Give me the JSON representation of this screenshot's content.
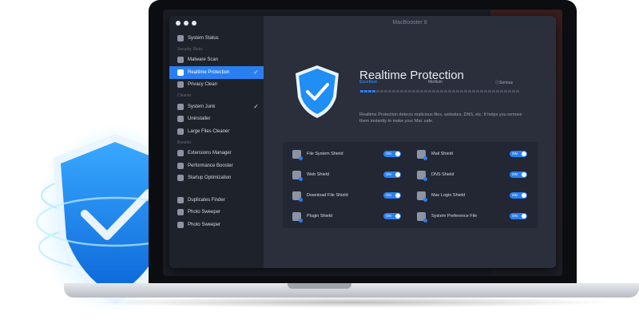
{
  "window": {
    "title": "MacBooster 8"
  },
  "sidebar": {
    "items": [
      {
        "type": "item",
        "label": "System Status",
        "icon": "gauge-icon"
      },
      {
        "type": "section",
        "label": "Security Risks"
      },
      {
        "type": "item",
        "label": "Malware Scan",
        "icon": "bug-icon"
      },
      {
        "type": "item",
        "label": "Realtime Protection",
        "icon": "shield-icon",
        "active": true,
        "checked": true
      },
      {
        "type": "item",
        "label": "Privacy Clean",
        "icon": "eye-icon"
      },
      {
        "type": "section",
        "label": "Cleaner"
      },
      {
        "type": "item",
        "label": "System Junk",
        "icon": "trash-icon",
        "checked": true
      },
      {
        "type": "item",
        "label": "Uninstaller",
        "icon": "box-icon"
      },
      {
        "type": "item",
        "label": "Large Files Cleaner",
        "icon": "file-icon"
      },
      {
        "type": "section",
        "label": "Booster"
      },
      {
        "type": "item",
        "label": "Extensions Manager",
        "icon": "puzzle-icon"
      },
      {
        "type": "item",
        "label": "Performance Booster",
        "icon": "rocket-icon"
      },
      {
        "type": "item",
        "label": "Startup Optimization",
        "icon": "power-icon"
      },
      {
        "type": "section",
        "label": ""
      },
      {
        "type": "item",
        "label": "Duplicates Finder",
        "icon": "copy-icon"
      },
      {
        "type": "item",
        "label": "Photo Sweeper",
        "icon": "photo-icon"
      },
      {
        "type": "item",
        "label": "Photo Sweeper",
        "icon": "photo-icon"
      }
    ]
  },
  "main": {
    "title": "Realtime Protection",
    "levels": [
      "Excellent",
      "Medium",
      "Serious"
    ],
    "level_value": 0.1,
    "description": "Realtime Protection detects malicious files, websites, DNS, etc. It helps you remove them instantly to make your Mac safe.",
    "shields": [
      {
        "label": "File System Shield",
        "state": "ON",
        "icon": "file-shield-icon"
      },
      {
        "label": "Mail Shield",
        "state": "ON",
        "icon": "mail-shield-icon"
      },
      {
        "label": "Web Shield",
        "state": "ON",
        "icon": "web-shield-icon"
      },
      {
        "label": "DNS Shield",
        "state": "ON",
        "icon": "dns-shield-icon"
      },
      {
        "label": "Download File Shield",
        "state": "ON",
        "icon": "download-shield-icon"
      },
      {
        "label": "Mac Login Shield",
        "state": "ON",
        "icon": "login-shield-icon"
      },
      {
        "label": "Plugin Shield",
        "state": "ON",
        "icon": "plugin-shield-icon"
      },
      {
        "label": "System Preference File",
        "state": "ON",
        "icon": "gear-shield-icon"
      }
    ]
  },
  "colors": {
    "accent": "#2a7ff0",
    "window_bg": "#2a2f3b",
    "sidebar_bg": "#1e222b",
    "shield_blue": "#1f8ef5"
  }
}
